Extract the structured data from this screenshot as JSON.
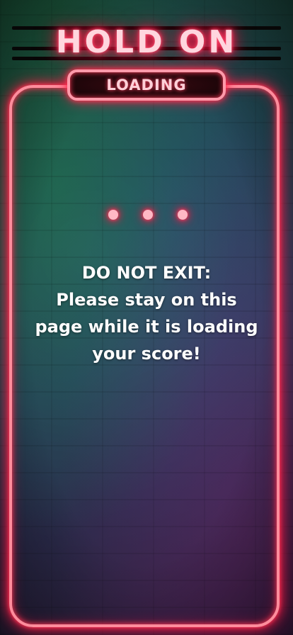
{
  "header": {
    "title": "HOLD ON"
  },
  "badge": {
    "label": "LOADING"
  },
  "loader": {
    "dot_count": 3,
    "color": "#ff1a44"
  },
  "message": {
    "lines": [
      "DO NOT EXIT:",
      "Please stay on this",
      "page while it is loading",
      "your score!"
    ]
  },
  "colors": {
    "neon": "#ff1a44",
    "neon_light": "#ffd6de",
    "text": "#ffffff"
  }
}
